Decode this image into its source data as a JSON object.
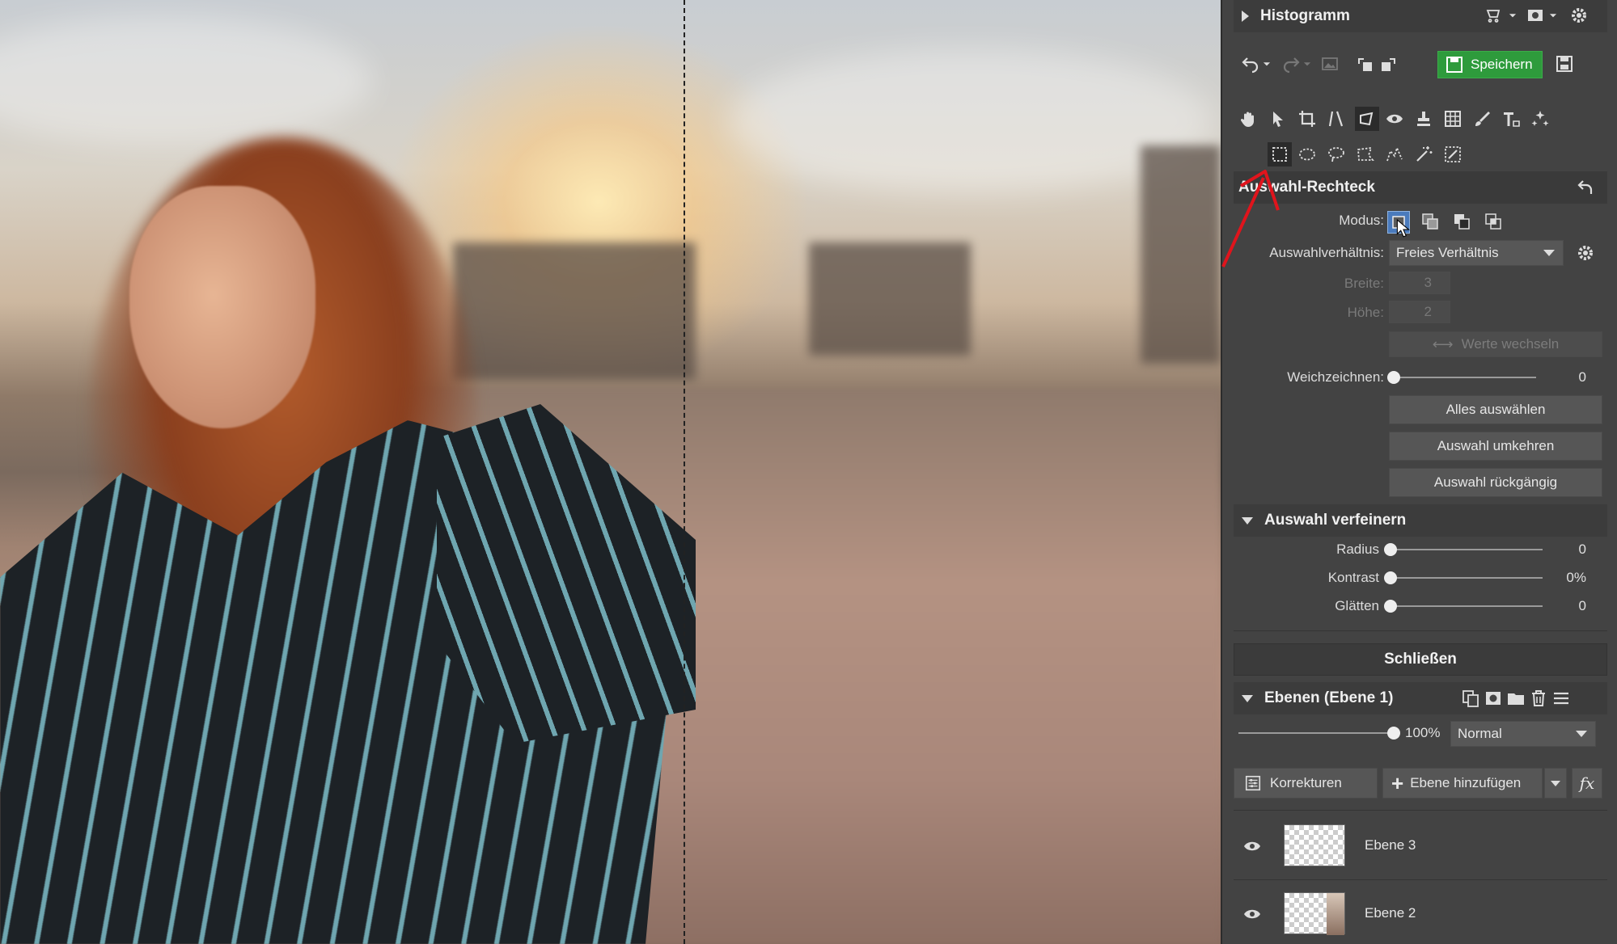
{
  "histogram": {
    "title": "Histogramm"
  },
  "toolbar": {
    "save_label": "Speichern"
  },
  "tool_panel": {
    "title": "Auswahl-Rechteck",
    "mode_label": "Modus:",
    "ratio_label": "Auswahlverhältnis:",
    "ratio_value": "Freies Verhältnis",
    "width_label": "Breite:",
    "width_value": "3",
    "height_label": "Höhe:",
    "height_value": "2",
    "swap_label": "Werte wechseln",
    "feather_label": "Weichzeichnen:",
    "feather_value": "0",
    "feather_level": 0,
    "select_all": "Alles auswählen",
    "invert": "Auswahl umkehren",
    "undo_selection": "Auswahl rückgängig"
  },
  "refine": {
    "title": "Auswahl verfeinern",
    "radius_label": "Radius",
    "radius_value": "0",
    "contrast_label": "Kontrast",
    "contrast_value": "0%",
    "smooth_label": "Glätten",
    "smooth_value": "0"
  },
  "close_label": "Schließen",
  "layers": {
    "title": "Ebenen (Ebene 1)",
    "opacity_value": "100%",
    "opacity_level": 1.0,
    "blend_mode": "Normal",
    "adjustments_label": "Korrekturen",
    "add_layer_label": "Ebene hinzufügen",
    "fx_label": "fx",
    "items": [
      {
        "name": "Ebene 3"
      },
      {
        "name": "Ebene 2"
      }
    ]
  },
  "colors": {
    "accent_green": "#2e9b3c",
    "annotation_red": "#e0141c",
    "panel_bg": "#434343"
  }
}
